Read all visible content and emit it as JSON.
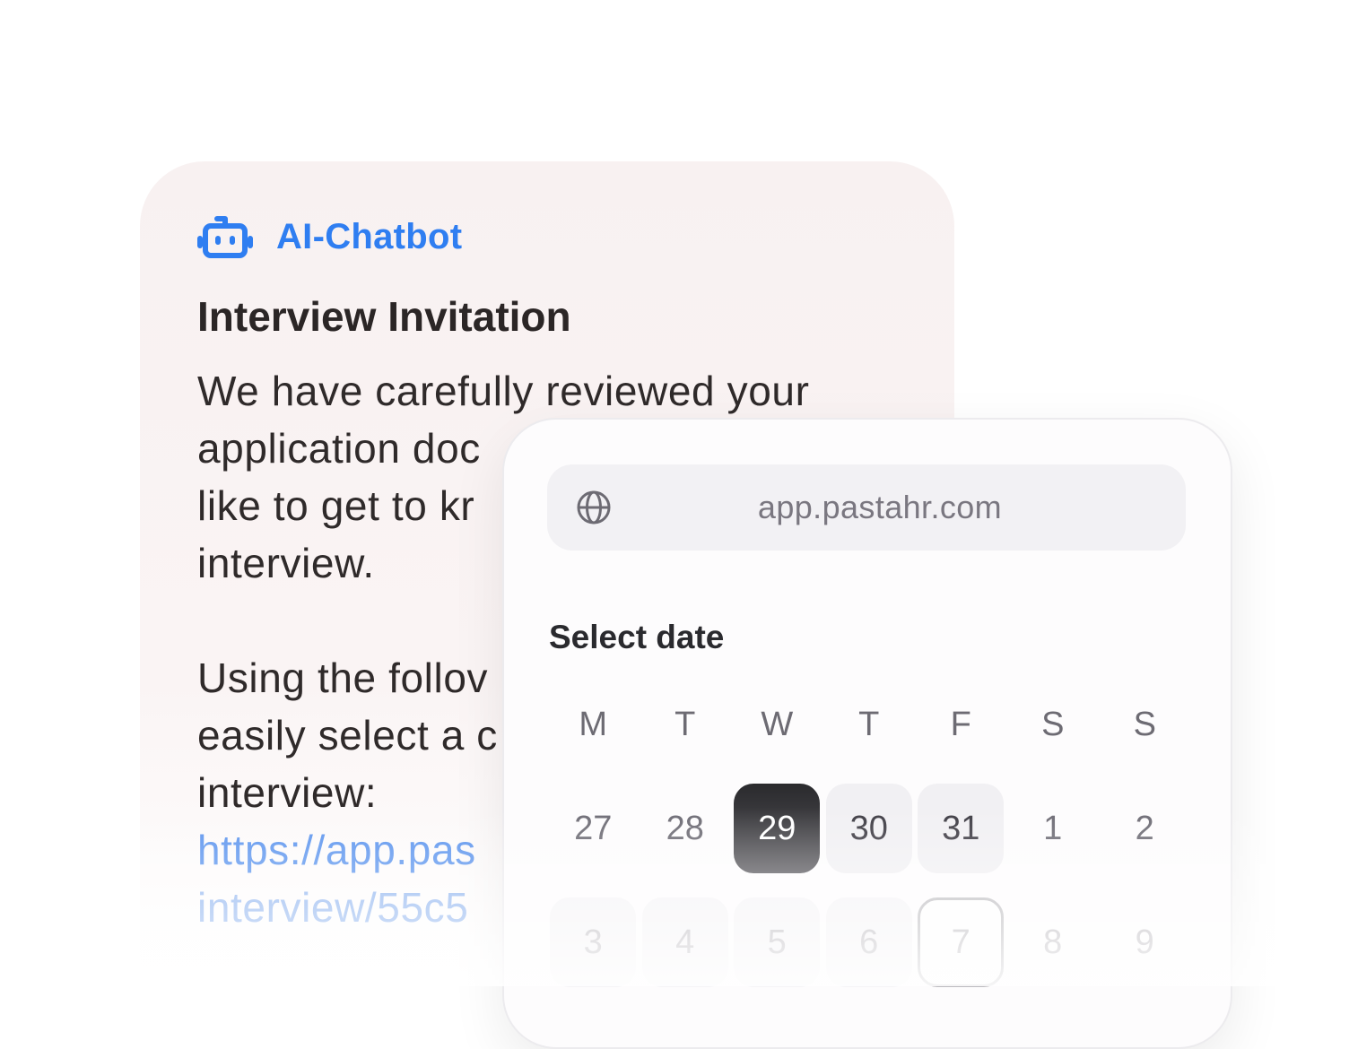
{
  "chat": {
    "bot_name": "AI-Chatbot",
    "bot_icon": "robot-icon",
    "title": "Interview Invitation",
    "paragraph1": [
      "We have carefully reviewed your",
      "application doc",
      "like to get to kr",
      "interview."
    ],
    "paragraph2": [
      "Using the follov",
      "easily select a c",
      "interview:"
    ],
    "link_lines": [
      "https://app.pas",
      "interview/55c5"
    ],
    "link_color": "#5b94ee",
    "accent_color": "#2f7ef1"
  },
  "browser": {
    "url": "app.pastahr.com",
    "url_icon": "globe-icon"
  },
  "calendar": {
    "heading": "Select date",
    "weekdays": [
      "M",
      "T",
      "W",
      "T",
      "F",
      "S",
      "S"
    ],
    "week1": [
      "27",
      "28",
      "29",
      "30",
      "31",
      "1",
      "2"
    ],
    "week2": [
      "3",
      "4",
      "5",
      "6",
      "7",
      "8",
      "9"
    ],
    "selected_day": "29",
    "today_outline_day": "7",
    "selected_color": "#2a2a2d"
  }
}
